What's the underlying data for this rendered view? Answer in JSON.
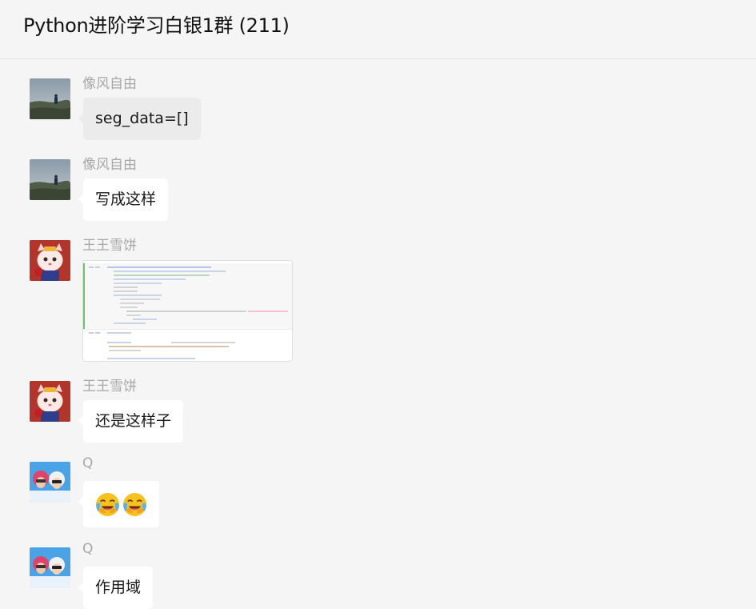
{
  "chat": {
    "title": "Python进阶学习白银1群 (211)"
  },
  "messages": [
    {
      "sender": "像风自由",
      "text": "seg_data=[]",
      "avatar": "landscape-avatar",
      "style": "grey"
    },
    {
      "sender": "像风自由",
      "text": "写成这样",
      "avatar": "landscape-avatar",
      "style": "white"
    },
    {
      "sender": "王王雪饼",
      "type": "image",
      "avatar": "cartoon-cat-avatar"
    },
    {
      "sender": "王王雪饼",
      "text": "还是这样子",
      "avatar": "cartoon-cat-avatar",
      "style": "white"
    },
    {
      "sender": "Q",
      "type": "emoji",
      "emoji": [
        "rolling-laughing-emoji",
        "rolling-laughing-emoji"
      ],
      "avatar": "two-people-avatar"
    },
    {
      "sender": "Q",
      "text": "作用域",
      "avatar": "two-people-avatar",
      "style": "white"
    }
  ],
  "colors": {
    "background": "#f5f5f5",
    "bubble": "#ffffff",
    "bubble_grey": "#ebebeb",
    "sender": "#a8a8a8"
  }
}
